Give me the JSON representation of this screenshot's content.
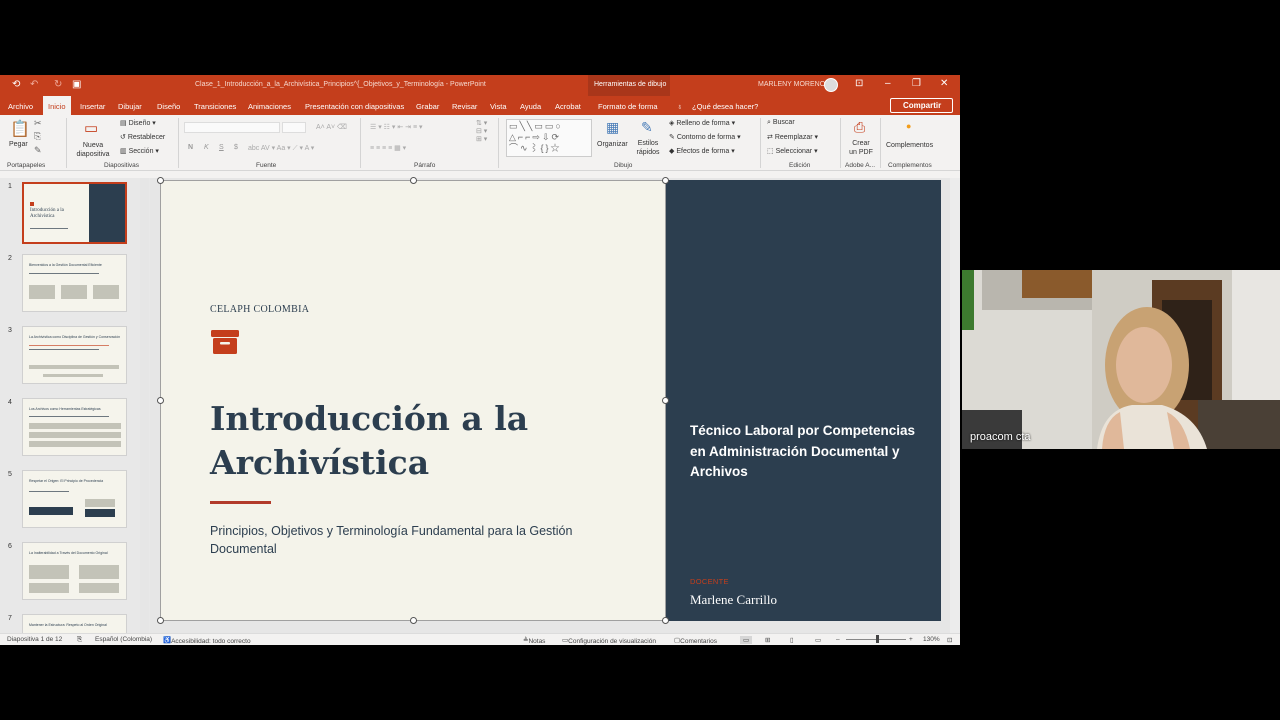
{
  "window": {
    "title": "Clase_1_Introducción_a_la_Archivística_Principios^{_Objetivos_y_Terminología - PowerPoint",
    "context_tools": "Herramientas de dibujo",
    "user": "MARLENY MORENO"
  },
  "tabs": [
    "Archivo",
    "Inicio",
    "Insertar",
    "Dibujar",
    "Diseño",
    "Transiciones",
    "Animaciones",
    "Presentación con diapositivas",
    "Grabar",
    "Revisar",
    "Vista",
    "Ayuda",
    "Acrobat",
    "Formato de forma"
  ],
  "active_tab": "Inicio",
  "tell_me": "¿Qué desea hacer?",
  "share": "Compartir",
  "ribbon": {
    "paste": "Pegar",
    "new_slide": "Nueva diapositiva",
    "layout": "Diseño",
    "reset": "Restablecer",
    "section": "Sección",
    "fill": "Relleno de forma",
    "outline": "Contorno de forma",
    "effects": "Efectos de forma",
    "arrange": "Organizar",
    "quick_styles": "Estilos rápidos",
    "find": "Buscar",
    "replace": "Reemplazar",
    "select": "Seleccionar",
    "create_pdf": "Crear un PDF",
    "addins": "Complementos",
    "groups": {
      "clipboard": "Portapapeles",
      "slides": "Diapositivas",
      "font": "Fuente",
      "paragraph": "Párrafo",
      "drawing": "Dibujo",
      "editing": "Edición",
      "adobe": "Adobe A...",
      "addins": "Complementos"
    },
    "font_buttons": [
      "N",
      "K",
      "S",
      "$"
    ]
  },
  "thumbnails": [
    {
      "num": "1",
      "title": "Introducción a la Archivística"
    },
    {
      "num": "2",
      "title": "Bienvenidos a la Gestión Documental Eficiente"
    },
    {
      "num": "3",
      "title": "La Archivística como Disciplina de Gestión y Conservación"
    },
    {
      "num": "4",
      "title": "Los Archivos como Herramientas Estratégicas"
    },
    {
      "num": "5",
      "title": "Respetar el Origen: El Principio de Procedencia"
    },
    {
      "num": "6",
      "title": "La Inalterabilidad a Través del Documento Original"
    },
    {
      "num": "7",
      "title": "Mantener la Estructura: Respeto al Orden Original"
    }
  ],
  "slide": {
    "org": "CELAPH COLOMBIA",
    "title": "Introducción a la Archivística",
    "subtitle": "Principios, Objetivos y Terminología Fundamental para la Gestión Documental",
    "right_title": "Técnico Laboral por Competencias en Administración Documental y Archivos",
    "role_label": "DOCENTE",
    "teacher": "Marlene Carrillo",
    "accent": "#c43e1c",
    "dark": "#2c3e4f"
  },
  "status": {
    "slide_count": "Diapositiva 1 de 12",
    "language": "Español (Colombia)",
    "accessibility": "Accesibilidad: todo correcto",
    "notes": "Notas",
    "display_settings": "Configuración de visualización",
    "comments": "Comentarios",
    "zoom": "130%"
  },
  "webcam": {
    "name": "proacom cta"
  }
}
